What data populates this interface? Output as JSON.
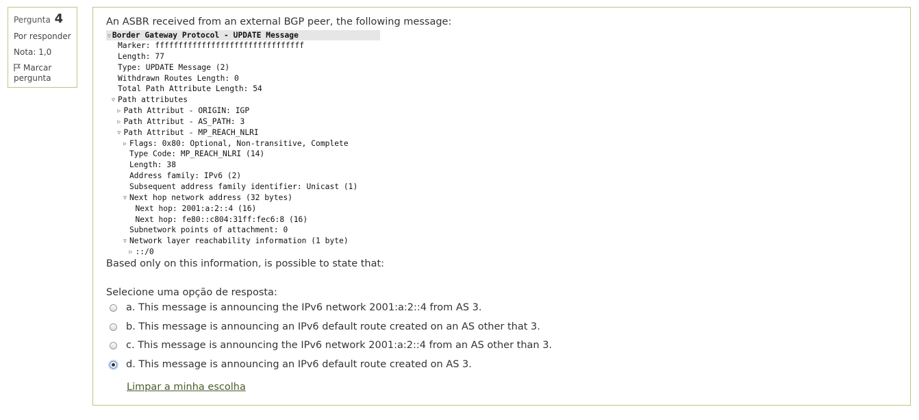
{
  "info": {
    "question_label": "Pergunta",
    "question_number": "4",
    "state": "Por responder",
    "grade": "Nota: 1,0",
    "flag_label": "Marcar pergunta",
    "flag_icon": "flag-icon"
  },
  "question": {
    "text": "An ASBR received from an external BGP peer, the following message:",
    "capture": {
      "header": "Border Gateway Protocol - UPDATE Message",
      "lines": [
        {
          "indent": 2,
          "tri": "",
          "text": "Marker: ffffffffffffffffffffffffffffffff"
        },
        {
          "indent": 2,
          "tri": "",
          "text": "Length: 77"
        },
        {
          "indent": 2,
          "tri": "",
          "text": "Type: UPDATE Message (2)"
        },
        {
          "indent": 2,
          "tri": "",
          "text": "Withdrawn Routes Length: 0"
        },
        {
          "indent": 2,
          "tri": "",
          "text": "Total Path Attribute Length: 54"
        },
        {
          "indent": 2,
          "tri": "down",
          "text": "Path attributes"
        },
        {
          "indent": 3,
          "tri": "right",
          "text": "Path Attribut - ORIGIN: IGP"
        },
        {
          "indent": 3,
          "tri": "right",
          "text": "Path Attribut - AS_PATH: 3"
        },
        {
          "indent": 3,
          "tri": "down",
          "text": "Path Attribut - MP_REACH_NLRI"
        },
        {
          "indent": 4,
          "tri": "right",
          "text": "Flags: 0x80: Optional, Non-transitive, Complete"
        },
        {
          "indent": 4,
          "tri": "",
          "text": "Type Code: MP_REACH_NLRI (14)"
        },
        {
          "indent": 4,
          "tri": "",
          "text": "Length: 38"
        },
        {
          "indent": 4,
          "tri": "",
          "text": "Address family: IPv6 (2)"
        },
        {
          "indent": 4,
          "tri": "",
          "text": "Subsequent address family identifier: Unicast (1)"
        },
        {
          "indent": 4,
          "tri": "down",
          "text": "Next hop network address (32 bytes)"
        },
        {
          "indent": 5,
          "tri": "",
          "text": "Next hop: 2001:a:2::4 (16)"
        },
        {
          "indent": 5,
          "tri": "",
          "text": "Next hop: fe80::c804:31ff:fec6:8 (16)"
        },
        {
          "indent": 4,
          "tri": "",
          "text": "Subnetwork points of attachment: 0"
        },
        {
          "indent": 4,
          "tri": "down",
          "text": "Network layer reachability information (1 byte)"
        },
        {
          "indent": 5,
          "tri": "right",
          "text": "::/0"
        }
      ]
    },
    "after_text": "Based only on this information, is possible to state that:",
    "prompt": "Selecione uma opção de resposta:",
    "options": [
      {
        "label": "a. This message is announcing the IPv6 network 2001:a:2::4 from AS 3.",
        "selected": false
      },
      {
        "label": "b. This message is announcing an IPv6 default route created on an AS other that 3.",
        "selected": false
      },
      {
        "label": "c. This message is announcing the IPv6 network 2001:a:2::4 from an AS other than 3.",
        "selected": false
      },
      {
        "label": "d. This message is announcing an IPv6 default route created on AS 3.",
        "selected": true
      }
    ],
    "clear_label": "Limpar a minha escolha"
  },
  "colors": {
    "border": "#b2c986",
    "link": "#4b5b2b"
  }
}
